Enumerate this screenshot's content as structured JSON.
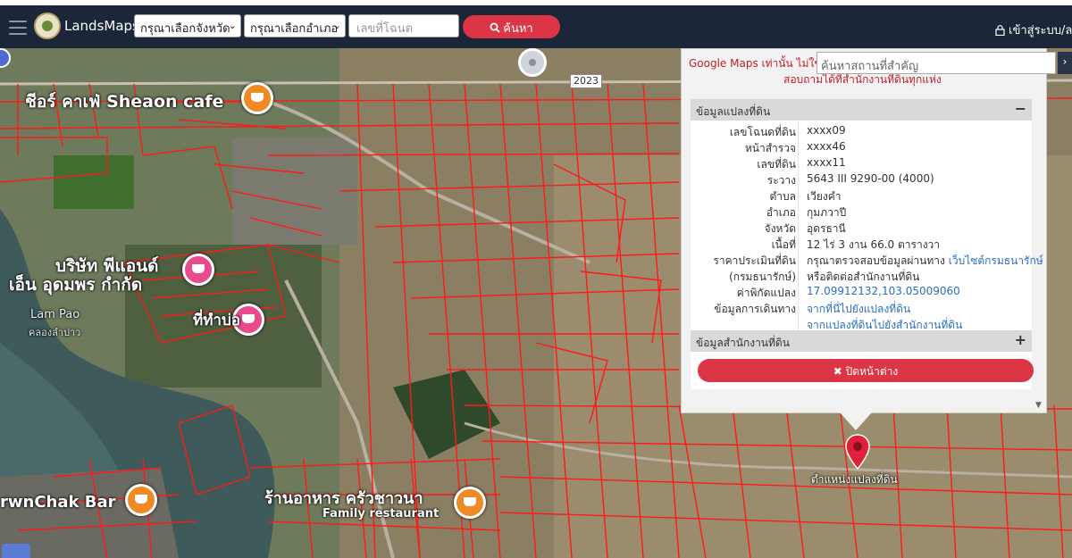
{
  "header": {
    "brand": "LandsMaps",
    "province_select": "กรุณาเลือกจังหวัด",
    "district_select": "กรุณาเลือกอำเภอ",
    "deed_placeholder": "เลขที่โฉนด",
    "search_label": "ค้นหา",
    "login_label": "เข้าสู่ระบบ/ลง"
  },
  "map": {
    "labels": {
      "shea": "ชีอร์ คาเฟ่ Sheaon cafe",
      "pnd1": "บริษัท พีแอนด์",
      "pnd2": "เอ็น อุดมพร กำกัด",
      "lampao": "Lam Pao",
      "lampao_th": "คลองลำปาว",
      "kam": "ที่ทำบ่อ",
      "rest": "ร้านอาหาร ครัวชาวนา",
      "family": "Family restaurant",
      "bar": "rwnChak Bar",
      "road": "2023",
      "position": "ตำแหน่งแปลงที่ดิน"
    }
  },
  "popup": {
    "gm_note": "Google Maps เท่านั้น ไม่ใช่ห",
    "gm_note2": "สอบถามได้ที่สำนักงานที่ดินทุกแห่ง",
    "place_search_placeholder": "ค้นหาสถานที่สำคัญ",
    "place_search_btn": "›",
    "section_parcel": "ข้อมูลแปลงที่ดิน",
    "section_parcel_sign": "−",
    "section_office": "ข้อมูลสำนักงานที่ดิน",
    "section_office_sign": "+",
    "rows": [
      {
        "k": "เลขโฉนดที่ดิน",
        "v": "xxxx09"
      },
      {
        "k": "หน้าสำรวจ",
        "v": "xxxx46"
      },
      {
        "k": "เลขที่ดิน",
        "v": "xxxx11"
      },
      {
        "k": "ระวาง",
        "v": "5643 III 9290-00 (4000)"
      },
      {
        "k": "ตำบล",
        "v": "เวียงคำ"
      },
      {
        "k": "อำเภอ",
        "v": "กุมภวาปี"
      },
      {
        "k": "จังหวัด",
        "v": "อุดรธานี"
      },
      {
        "k": "เนื้อที่",
        "v": "12 ไร่ 3 งาน 66.0 ตารางวา"
      },
      {
        "k": "ราคาประเมินที่ดิน",
        "v": "กรุณาตรวจสอบข้อมูลผ่านทาง",
        "v_link": "เว็บไซต์กรมธนารักษ์"
      },
      {
        "k": "(กรมธนารักษ์)",
        "v": "หรือติดต่อสำนักงานที่ดิน"
      },
      {
        "k": "ค่าพิกัดแปลง",
        "v": "17.09912132,103.05009060"
      },
      {
        "k": "ข้อมูลการเดินทาง",
        "v": "จากที่นี่ไปยังแปลงที่ดิน"
      },
      {
        "k": "",
        "v": "จากแปลงที่ดินไปยังสำนักงานที่ดิน"
      }
    ],
    "close_label": "✖ ปิดหน้าต่าง"
  }
}
